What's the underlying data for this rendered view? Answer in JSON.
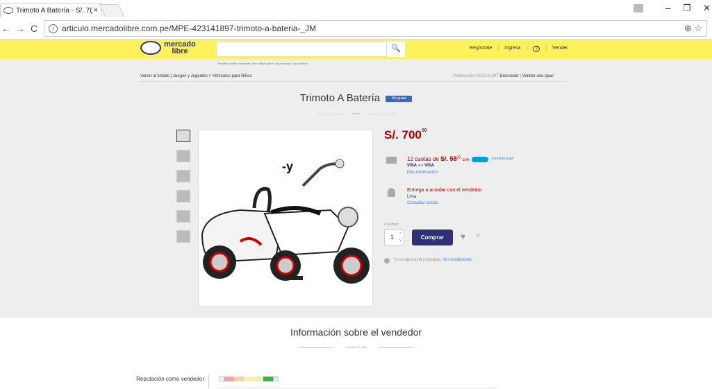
{
  "browser": {
    "tab_title": "Trimoto A Batería - S/. 7(",
    "tab_close": "×",
    "url": "articulo.mercadolibre.com.pe/MPE-423141897-trimoto-a-bateria-_JM"
  },
  "header": {
    "logo_line1": "mercado",
    "logo_line2": "libre",
    "search_placeholder": "",
    "nav": {
      "register": "Regístrate",
      "login": "Ingresa",
      "help": "?",
      "sell": "Vender"
    },
    "suggestions": "También puede interesarte:  merf,  fidget spiner,  lego ninjago,  carro bateria"
  },
  "breadcrumb": {
    "back": "Volver al listado",
    "path": "Juegos y Juguetes > Vehículos para Niños",
    "pub_prefix": "Publicación #423141897",
    "report": "Denunciar",
    "sell_same": "Vender uno igual"
  },
  "product": {
    "title": "Trimoto A Batería",
    "like_label": "Me gusta",
    "condition": "Nuevo",
    "price_main": "S/. 700",
    "price_cents": "00",
    "installments_prefix": "12 cuotas de",
    "installment_amount": "S/. 58",
    "installment_cents": "33",
    "installments_with": "con",
    "mp_label": "mercado pago",
    "cards": "VISA ---- VISA",
    "more_info": "Más información",
    "delivery": "Entrega a acordar con el vendedor",
    "location": "Lima",
    "shipping_costs": "Consultar costos",
    "quantity_label": "Cantidad:",
    "quantity": "1",
    "buy_label": "Comprar",
    "protected_text": "Tu compra está protegida.",
    "protected_link": "Ver condiciones",
    "image_annotation": "-y"
  },
  "seller": {
    "title": "Información sobre el vendedor",
    "location": "Ubicado en Lima",
    "reputation_label": "Reputación como vendedor",
    "thermometer_colors": [
      "#f4a3a3",
      "#fbd0a9",
      "#fef2a1",
      "#e7f5a6",
      "#39b54a"
    ]
  }
}
